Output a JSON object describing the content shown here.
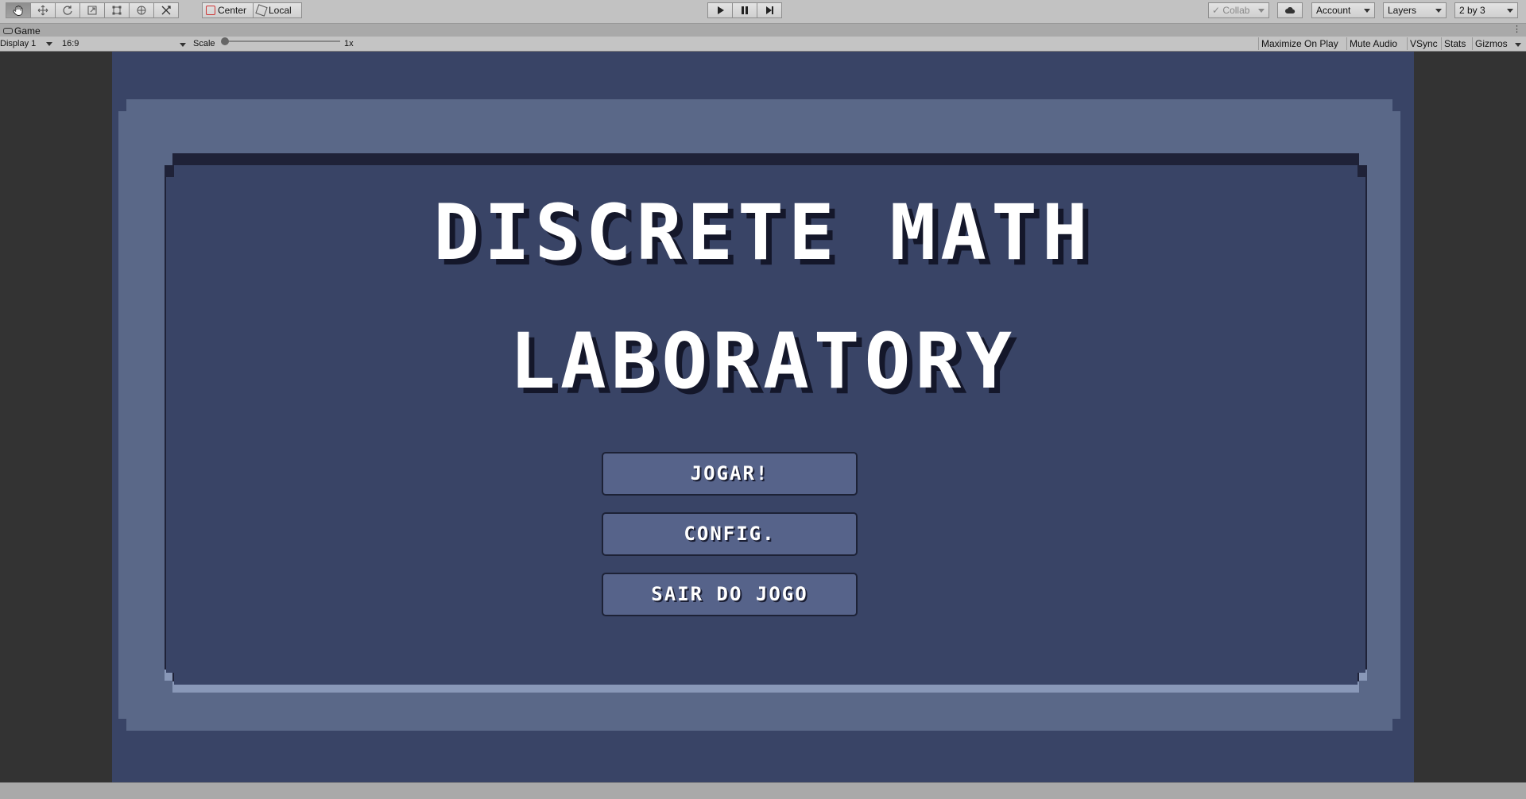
{
  "toolbar": {
    "pivot_label": "Center",
    "space_label": "Local",
    "collab_label": "Collab",
    "account_label": "Account",
    "layers_label": "Layers",
    "layout_label": "2 by 3"
  },
  "game_view": {
    "tab_label": "Game",
    "display_label": "Display 1",
    "aspect_label": "16:9",
    "scale_label": "Scale",
    "scale_value": "1x",
    "toggles": [
      "Maximize On Play",
      "Mute Audio",
      "VSync",
      "Stats",
      "Gizmos"
    ]
  },
  "game": {
    "title_line1": "DISCRETE MATH",
    "title_line2": "LABORATORY",
    "buttons": [
      "JOGAR!",
      "CONFIG.",
      "SAIR DO JOGO"
    ]
  },
  "colors": {
    "background": "#394466",
    "frame": "#5a6888",
    "button": "#56638a"
  }
}
